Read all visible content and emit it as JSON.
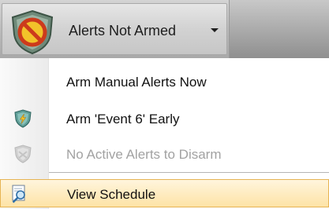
{
  "toolbar": {
    "alerts_button": {
      "label": "Alerts Not Armed",
      "icon": "shield-no-icon",
      "has_dropdown": true
    }
  },
  "menu": {
    "items": [
      {
        "label": "Arm Manual Alerts Now",
        "icon": "",
        "enabled": true
      },
      {
        "label": "Arm 'Event 6' Early",
        "icon": "shield-bolt-icon",
        "enabled": true
      },
      {
        "label": "No Active Alerts to Disarm",
        "icon": "shield-disabled-icon",
        "enabled": false
      },
      {
        "label": "View Schedule",
        "icon": "magnifier-document-icon",
        "enabled": true,
        "highlighted": true
      }
    ]
  },
  "colors": {
    "highlight_background": "#fde3a6",
    "highlight_border": "#e6b454",
    "disabled_text": "#a2a2a2",
    "shield_red": "#cc3b1c",
    "shield_gold": "#f2c22a"
  }
}
